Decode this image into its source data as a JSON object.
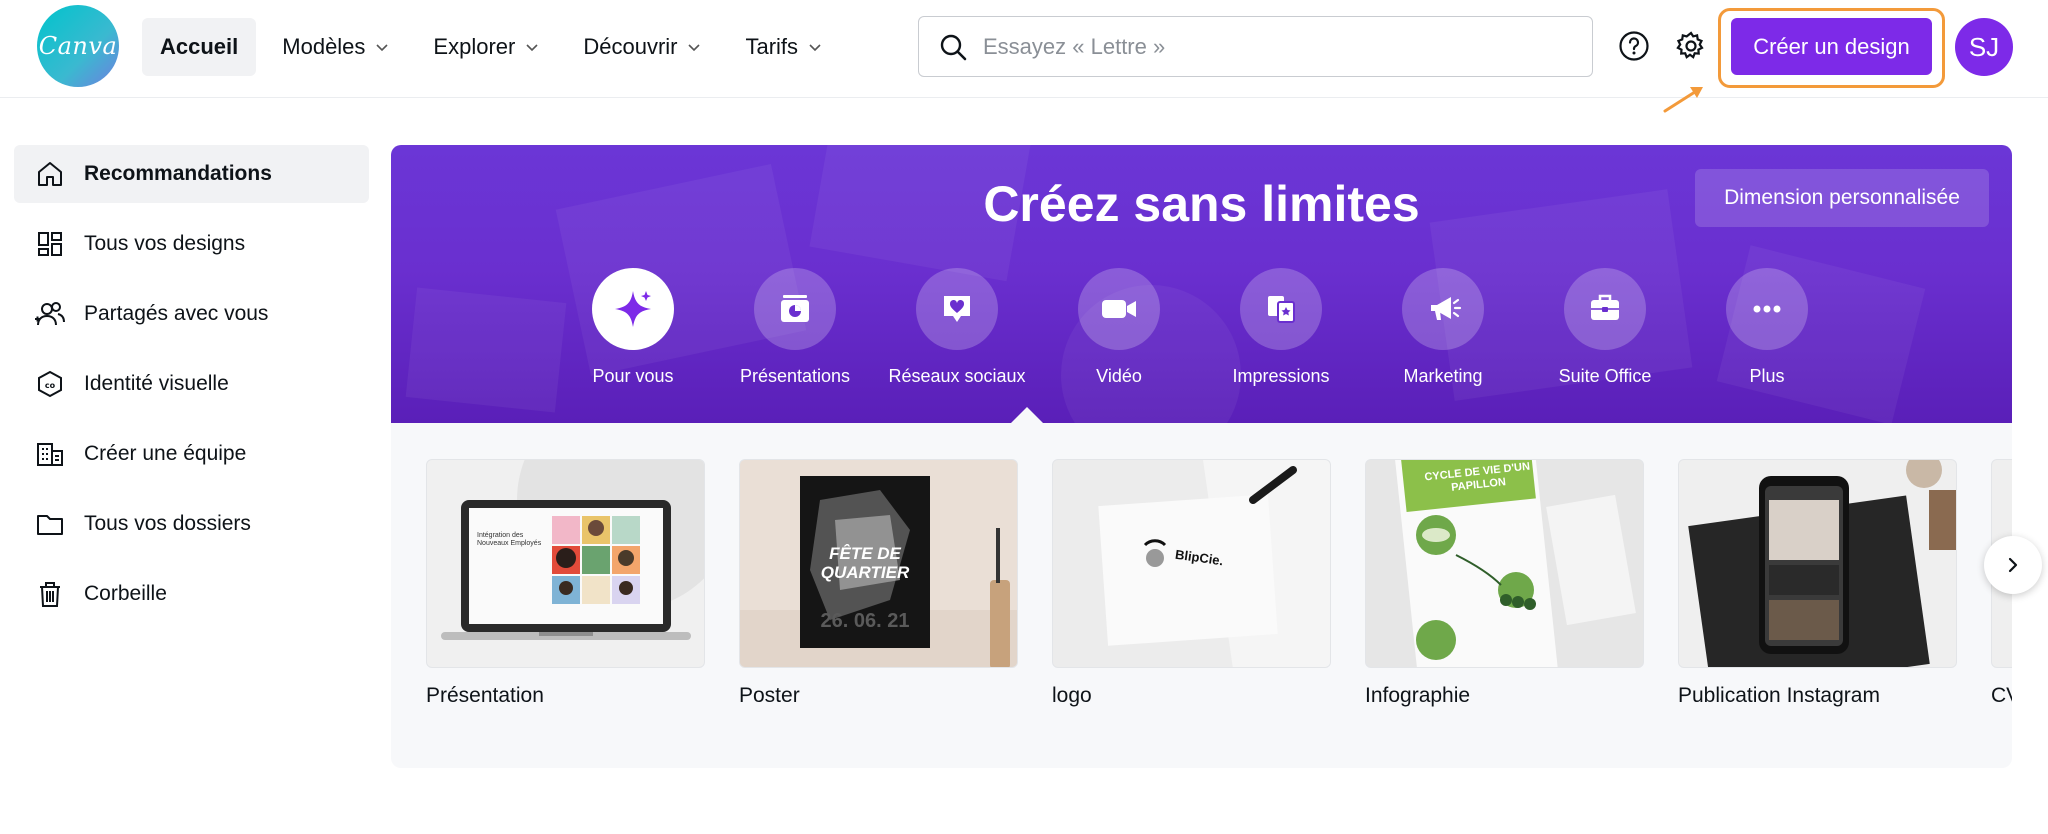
{
  "brand": {
    "logo_text": "Canva",
    "accent": "#7d2ae8",
    "highlight": "#f39a3a"
  },
  "header": {
    "nav": [
      {
        "label": "Accueil",
        "active": true,
        "dropdown": false
      },
      {
        "label": "Modèles",
        "active": false,
        "dropdown": true
      },
      {
        "label": "Explorer",
        "active": false,
        "dropdown": true
      },
      {
        "label": "Découvrir",
        "active": false,
        "dropdown": true
      },
      {
        "label": "Tarifs",
        "active": false,
        "dropdown": true
      }
    ],
    "search": {
      "placeholder": "Essayez « Lettre »",
      "value": ""
    },
    "create_button": "Créer un design",
    "avatar_initials": "SJ"
  },
  "sidebar": {
    "items": [
      {
        "label": "Recommandations",
        "icon": "home-icon",
        "active": true
      },
      {
        "label": "Tous vos designs",
        "icon": "grid-icon",
        "active": false
      },
      {
        "label": "Partagés avec vous",
        "icon": "users-icon",
        "active": false
      },
      {
        "label": "Identité visuelle",
        "icon": "brand-kit-icon",
        "active": false
      },
      {
        "label": "Créer une équipe",
        "icon": "building-icon",
        "active": false
      },
      {
        "label": "Tous vos dossiers",
        "icon": "folder-icon",
        "active": false
      },
      {
        "label": "Corbeille",
        "icon": "trash-icon",
        "active": false
      }
    ]
  },
  "hero": {
    "title": "Créez sans limites",
    "custom_size_button": "Dimension personnalisée",
    "categories": [
      {
        "label": "Pour vous",
        "icon": "sparkle-icon",
        "active": true
      },
      {
        "label": "Présentations",
        "icon": "presentation-icon",
        "active": false
      },
      {
        "label": "Réseaux sociaux",
        "icon": "heart-chat-icon",
        "active": false
      },
      {
        "label": "Vidéo",
        "icon": "video-camera-icon",
        "active": false
      },
      {
        "label": "Impressions",
        "icon": "print-icon",
        "active": false
      },
      {
        "label": "Marketing",
        "icon": "megaphone-icon",
        "active": false
      },
      {
        "label": "Suite Office",
        "icon": "briefcase-icon",
        "active": false
      },
      {
        "label": "Plus",
        "icon": "more-icon",
        "active": false
      }
    ]
  },
  "templates": {
    "items": [
      {
        "label": "Présentation",
        "thumb_title": "Intégration des Nouveaux Employés",
        "icon": "laptop-icon"
      },
      {
        "label": "Poster",
        "thumb_title": "FÊTE DE QUARTIER",
        "thumb_date": "26. 06. 21",
        "icon": "poster-icon"
      },
      {
        "label": "logo",
        "thumb_title": "BlipCie.",
        "icon": "logo-icon"
      },
      {
        "label": "Infographie",
        "thumb_title": "CYCLE DE VIE D'UN PAPILLON",
        "icon": "infographic-icon"
      },
      {
        "label": "Publication Instagram",
        "icon": "phone-icon"
      },
      {
        "label": "CV",
        "icon": "cv-icon"
      }
    ]
  }
}
